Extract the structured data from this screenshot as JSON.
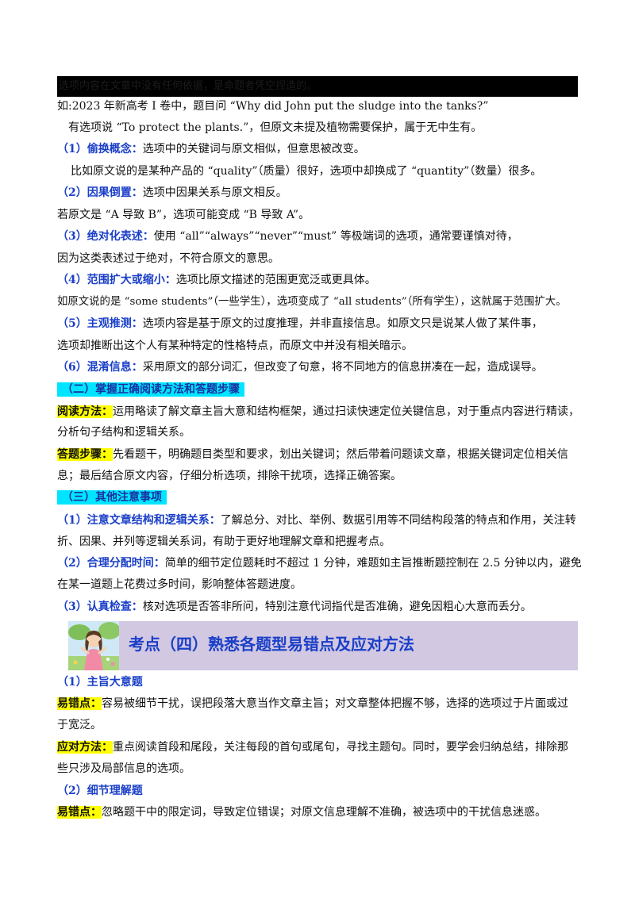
{
  "header_strip": "选项内容在文章中没有任何依据，是命题者凭空捏造的。",
  "lines": [
    {
      "text": "如:2023 年新高考 I 卷中，题目问 “Why did John put the sludge into the tanks?”"
    },
    {
      "text": "有选项说 “To protect the plants.”，但原文未提及植物需要保护，属于无中生有。"
    },
    {
      "label": "（1）偷换概念：",
      "text": "选项中的关键词与原文相似，但意思被改变。"
    },
    {
      "text": "比如原文说的是某种产品的 “quality”（质量）很好，选项中却换成了 “quantity”（数量）很多。"
    },
    {
      "label": "（2）因果倒置：",
      "text": "选项中因果关系与原文相反。"
    },
    {
      "text": "若原文是 “A 导致 B”，选项可能变成 “B 导致 A”。"
    },
    {
      "label": "（3）绝对化表述：",
      "text": "使用 “all”“always”“never”“must” 等极端词的选项，通常要谨慎对待，"
    },
    {
      "text": "因为这类表述过于绝对，不符合原文的意思。"
    },
    {
      "label": "（4）范围扩大或缩小：",
      "text": "选项比原文描述的范围更宽泛或更具体。"
    },
    {
      "text": "如原文说的是 “some students”（一些学生），选项变成了 “all students”（所有学生），这就属于范围扩大。"
    },
    {
      "label": "（5）主观推测：",
      "text": "选项内容是基于原文的过度推理，并非直接信息。如原文只是说某人做了某件事，"
    },
    {
      "text": "选项却推断出这个人有某种特定的性格特点，而原文中并没有相关暗示。"
    },
    {
      "label": "（6）混淆信息：",
      "text": "采用原文的部分词汇，但改变了句意，将不同地方的信息拼凑在一起，造成误导。"
    },
    {
      "heading": "（二）掌握正确阅读方法和答题步骤"
    },
    {
      "tag": "阅读方法：",
      "text": "运用略读了解文章主旨大意和结构框架，通过扫读快速定位关键信息，对于重点内容进行精读，"
    },
    {
      "text": "分析句子结构和逻辑关系。"
    },
    {
      "tag": "答题步骤：",
      "text": "先看题干，明确题目类型和要求，划出关键词；然后带着问题读文章，根据关键词定位相关信"
    },
    {
      "text": "息；最后结合原文内容，仔细分析选项，排除干扰项，选择正确答案。"
    },
    {
      "heading": "（三）其他注意事项"
    },
    {
      "label": "（1）注意文章结构和逻辑关系：",
      "text": "了解总分、对比、举例、数据引用等不同结构段落的特点和作用，关注转"
    },
    {
      "text": "折、因果、并列等逻辑关系词，有助于更好地理解文章和把握考点。"
    },
    {
      "label": "（2）合理分配时间：",
      "text": "简单的细节定位题耗时不超过 1 分钟，难题如主旨推断题控制在 2.5 分钟以内，避免"
    },
    {
      "text": "在某一道题上花费过多时间，影响整体答题进度。"
    },
    {
      "label": "（3）认真检查：",
      "text": "核对选项是否答非所问，特别注意代词指代是否准确，避免因粗心大意而丢分。"
    }
  ],
  "banner": {
    "title": "考点（四）熟悉各题型易错点及应对方法"
  },
  "lines2": [
    {
      "label": "（1）主旨大意题"
    },
    {
      "tag": "易错点：",
      "text": "容易被细节干扰，误把段落大意当作文章主旨；对文章整体把握不够，选择的选项过于片面或过"
    },
    {
      "text": "于宽泛。"
    },
    {
      "tag": "应对方法：",
      "text": "重点阅读首段和尾段，关注每段的首句或尾句，寻找主题句。同时，要学会归纳总结，排除那"
    },
    {
      "text": "些只涉及局部信息的选项。"
    },
    {
      "label": "（2）细节理解题"
    },
    {
      "tag": "易错点：",
      "text": "忽略题干中的限定词，导致定位错误；对原文信息理解不准确，被选项中的干扰信息迷惑。"
    }
  ]
}
